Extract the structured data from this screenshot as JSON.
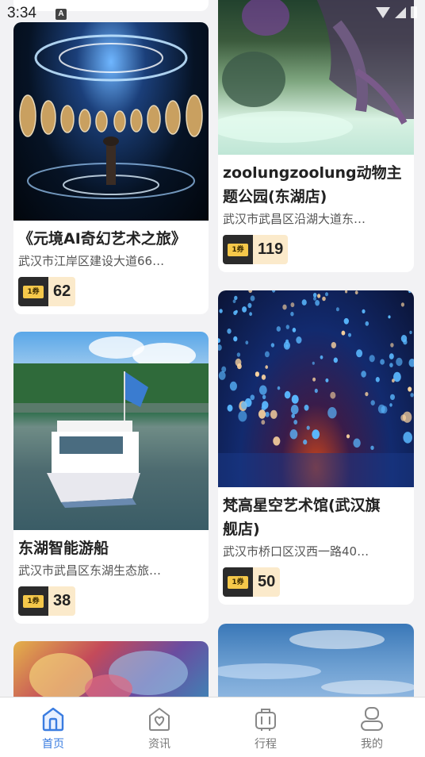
{
  "status": {
    "time": "3:34",
    "notif_letter": "A"
  },
  "cards_left": [
    {
      "title": "《元境AI奇幻艺术之旅》",
      "address": "武汉市江岸区建设大道66…",
      "price": "62",
      "ticket_label": "1券"
    },
    {
      "title": "东湖智能游船",
      "address": "武汉市武昌区东湖生态旅…",
      "price": "38",
      "ticket_label": "1券"
    }
  ],
  "cards_right": [
    {
      "title_line1": "zoolungzoolung动物主",
      "title_line2": "题公园(东湖店)",
      "address": "武汉市武昌区沿湖大道东…",
      "price": "119",
      "ticket_label": "1券"
    },
    {
      "title_line1": "梵高星空艺术馆(武汉旗",
      "title_line2": "舰店)",
      "address": "武汉市桥口区汉西一路40…",
      "price": "50",
      "ticket_label": "1券"
    }
  ],
  "tabbar": {
    "items": [
      {
        "label": "首页",
        "icon": "home-icon",
        "active": true
      },
      {
        "label": "资讯",
        "icon": "news-icon",
        "active": false
      },
      {
        "label": "行程",
        "icon": "luggage-icon",
        "active": false
      },
      {
        "label": "我的",
        "icon": "profile-icon",
        "active": false
      }
    ]
  },
  "colors": {
    "accent": "#3a7ce0",
    "price_bg": "#fbeacb",
    "ticket_bg": "#2b2b2b",
    "ticket_gold": "#f5c84a"
  }
}
